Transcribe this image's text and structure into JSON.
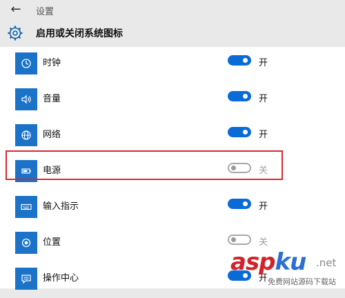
{
  "window": {
    "back_glyph": "←",
    "title": "设置"
  },
  "page": {
    "title": "启用或关闭系统图标"
  },
  "rows": [
    {
      "label": "时钟",
      "icon": "clock-icon",
      "on": true,
      "state_text": "开"
    },
    {
      "label": "音量",
      "icon": "volume-icon",
      "on": true,
      "state_text": "开"
    },
    {
      "label": "网络",
      "icon": "network-globe-icon",
      "on": true,
      "state_text": "开"
    },
    {
      "label": "电源",
      "icon": "battery-icon",
      "on": false,
      "state_text": "关"
    },
    {
      "label": "输入指示",
      "icon": "keyboard-icon",
      "on": true,
      "state_text": "开"
    },
    {
      "label": "位置",
      "icon": "location-icon",
      "on": false,
      "state_text": "关"
    },
    {
      "label": "操作中心",
      "icon": "action-center-icon",
      "on": true,
      "state_text": "开"
    }
  ],
  "colors": {
    "accent": "#0a6ad6",
    "icon_tile": "#1a73c8",
    "highlight": "#d9262e"
  },
  "watermark": {
    "brand_a": "asp",
    "brand_b": "ku",
    "suffix": ".net",
    "subtitle": "免费网站源码下载站"
  }
}
